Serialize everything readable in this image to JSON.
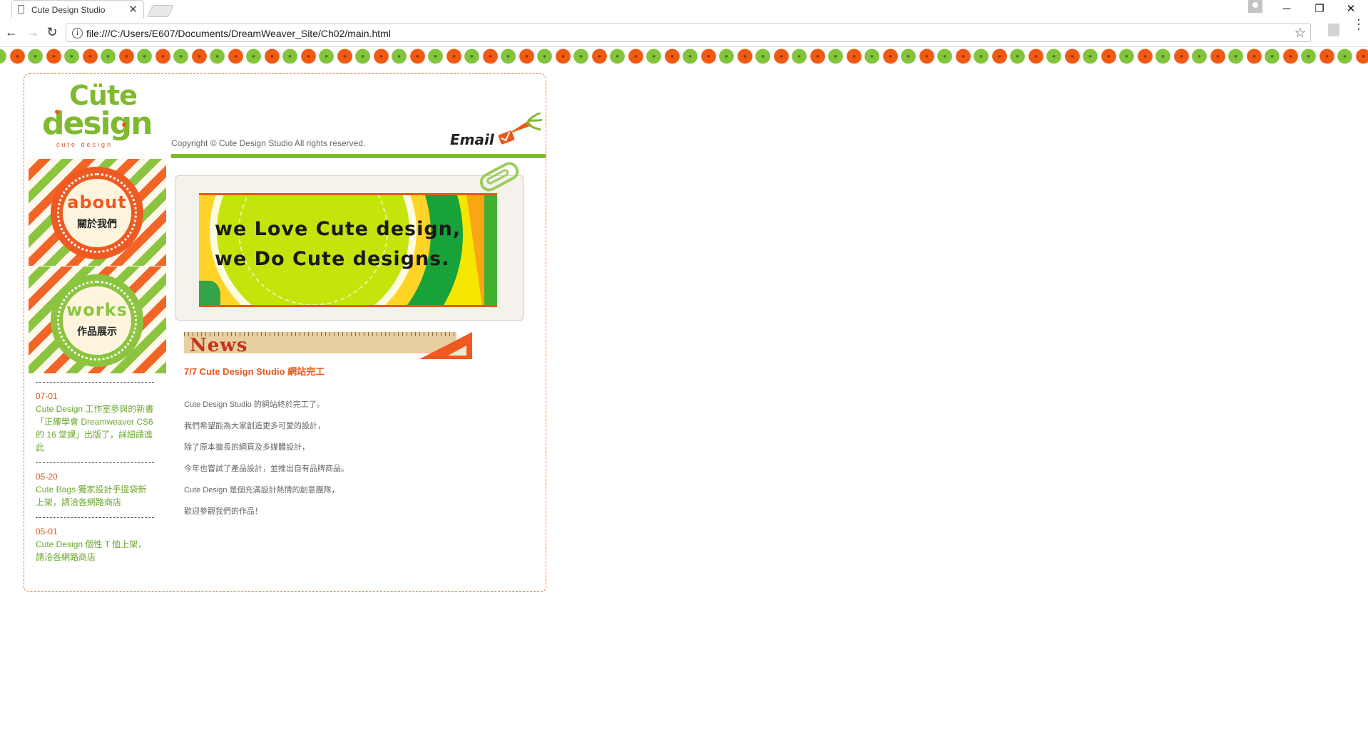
{
  "browser": {
    "tab_title": "Cute Design Studio",
    "tab_close": "✕",
    "url": "file:///C:/Users/E607/Documents/DreamWeaver_Site/Ch02/main.html",
    "window_minimize": "─",
    "window_restore": "❐",
    "window_close": "✕",
    "nav_back": "←",
    "nav_forward": "→",
    "nav_reload": "↻",
    "star": "☆",
    "info": "i",
    "menu": "⋮"
  },
  "page": {
    "logo": {
      "top": "Cüte",
      "bottom": "design",
      "sub": "cute design"
    },
    "copyright": "Copyright © Cute Design Studio All rights reserved.",
    "email_label": "Email",
    "menu": [
      {
        "en": "about",
        "zh": "關於我們"
      },
      {
        "en": "works",
        "zh": "作品展示"
      }
    ],
    "banner": {
      "line1": "we Love Cute design,",
      "line2": "we Do Cute designs."
    },
    "news_heading": "News",
    "news_items": [
      {
        "date": "07-01",
        "text": "Cute Design 工作室參與的新書「正確學會 Dreamweaver CS6 的 16 堂課」出版了，詳細請進此"
      },
      {
        "date": "05-20",
        "text": "Cute Bags 獨家設計手提袋新上架，請洽各網路商店"
      },
      {
        "date": "05-01",
        "text": "Cute Design 個性 T 恤上架，請洽各網路商店"
      }
    ],
    "article": {
      "title": "7/7 Cute Design Studio 網站完工",
      "lines": [
        "Cute Design Studio 的網站終於完工了。",
        "我們希望能為大家創造更多可愛的設計，",
        "除了原本擅長的網頁及多媒體設計，",
        "今年也嘗試了產品設計，並推出自有品牌商品。",
        "Cute Design 是個充滿設計熱情的創意團隊，",
        "歡迎參觀我們的作品！"
      ]
    }
  },
  "colors": {
    "accent_orange": "#ee5a22",
    "accent_green": "#8bc540",
    "text_gray": "#666666"
  }
}
